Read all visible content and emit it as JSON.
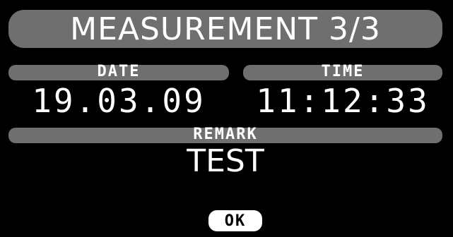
{
  "title": "MEASUREMENT 3/3",
  "date": {
    "label": "DATE",
    "value": "19.03.09"
  },
  "time": {
    "label": "TIME",
    "value": "11:12:33"
  },
  "remark": {
    "label": "REMARK",
    "value": "TEST"
  },
  "ok_button": "OK",
  "colors": {
    "background": "#000000",
    "header_pill": "#6f6f6f",
    "text": "#ffffff"
  }
}
